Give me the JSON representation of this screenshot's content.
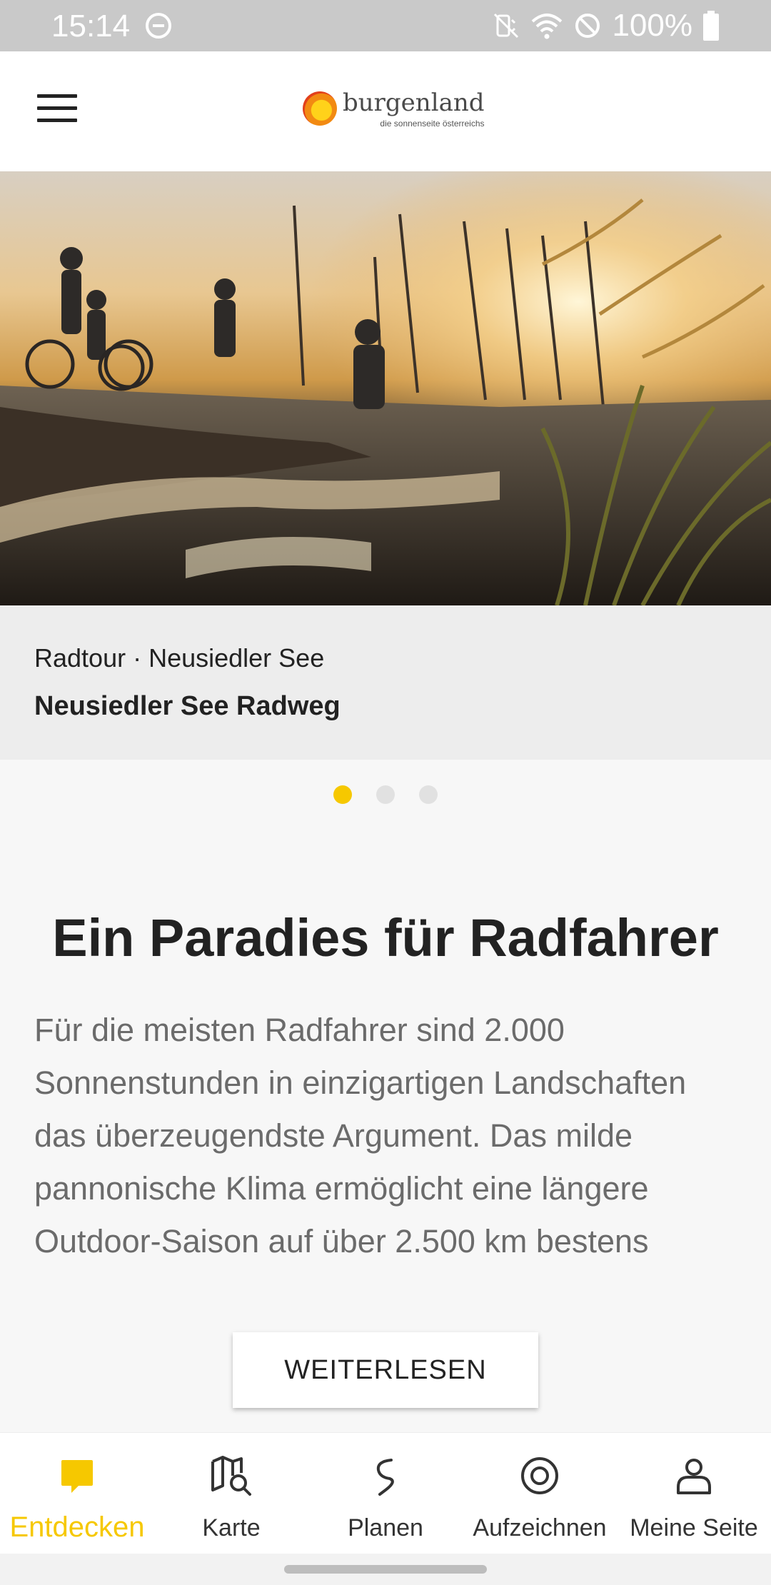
{
  "status_bar": {
    "time": "15:14",
    "battery": "100%",
    "icons": [
      "do-not-disturb-icon",
      "mute-icon",
      "wifi-icon",
      "blocked-icon",
      "battery-icon"
    ]
  },
  "app_bar": {
    "menu_icon": "hamburger-icon",
    "logo": {
      "name": "burgenland",
      "claim": "die sonnenseite österreichs"
    }
  },
  "hero_card": {
    "category": "Radtour",
    "separator": "·",
    "location": "Neusiedler See",
    "title": "Neusiedler See Radweg"
  },
  "pager": {
    "count": 3,
    "active_index": 0,
    "active_color": "#f6c800",
    "inactive_color": "#e1e1e1"
  },
  "content": {
    "headline": "Ein Paradies für Radfahrer",
    "intro": "Für die meisten Radfahrer sind 2.000 Sonnenstunden in einzigartigen Landschaften das überzeugendste Argument. Das milde pannonische Klima ermöglicht eine längere Outdoor-Saison auf über 2.500 km bestens",
    "read_more_label": "WEITERLESEN"
  },
  "bottom_nav": {
    "accent_color": "#f6c800",
    "items": [
      {
        "label": "Entdecken",
        "icon": "discover-icon",
        "active": true
      },
      {
        "label": "Karte",
        "icon": "map-search-icon",
        "active": false
      },
      {
        "label": "Planen",
        "icon": "route-icon",
        "active": false
      },
      {
        "label": "Aufzeichnen",
        "icon": "record-icon",
        "active": false
      },
      {
        "label": "Meine Seite",
        "icon": "user-icon",
        "active": false
      }
    ]
  }
}
